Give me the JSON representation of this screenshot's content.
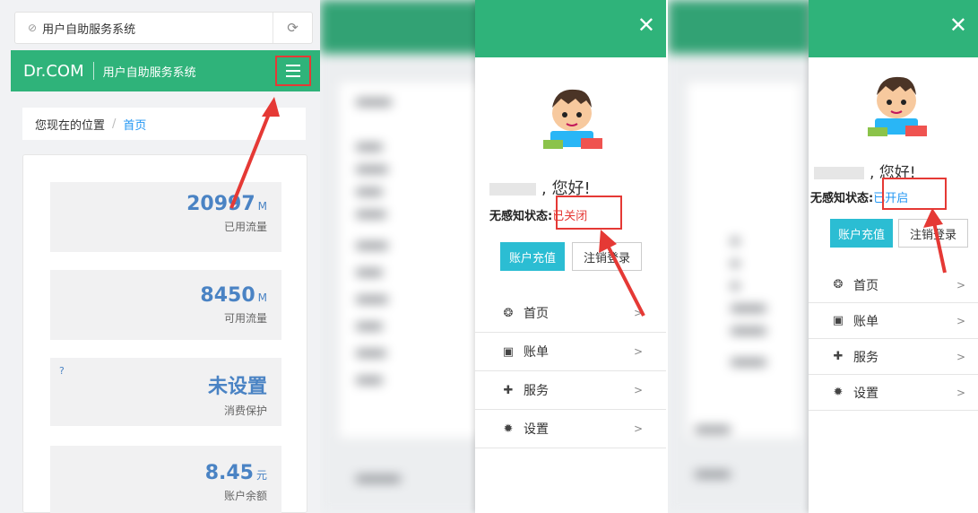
{
  "screen1": {
    "url_text": "用户自助服务系统",
    "lock_icon": "⊘",
    "reload_icon": "⟳",
    "brand": "Dr.COM",
    "system_name": "用户自助服务系统",
    "breadcrumb": {
      "prefix": "您现在的位置",
      "separator": "/",
      "current": "首页"
    },
    "stats": [
      {
        "value": "20997",
        "unit": "M",
        "label": "已用流量"
      },
      {
        "value": "8450",
        "unit": "M",
        "label": "可用流量"
      },
      {
        "value": "未设置",
        "unit": "",
        "label": "消费保护",
        "help": "?"
      },
      {
        "value": "8.45",
        "unit": "元",
        "label": "账户余额"
      }
    ]
  },
  "screen2": {
    "close_icon": "✕",
    "greeting": ", 您好!",
    "status_label": "无感知状态:",
    "status_value": "已关闭",
    "status_color": "#e53935",
    "btn_recharge": "账户充值",
    "btn_logout": "注销登录",
    "menu": [
      {
        "icon": "dashboard-icon",
        "glyph": "❂",
        "label": "首页",
        "chevron": ">"
      },
      {
        "icon": "bill-icon",
        "glyph": "▣",
        "label": "账单",
        "chevron": ">"
      },
      {
        "icon": "puzzle-icon",
        "glyph": "✚",
        "label": "服务",
        "chevron": ">"
      },
      {
        "icon": "gear-icon",
        "glyph": "✹",
        "label": "设置",
        "chevron": ">"
      }
    ]
  },
  "screen3": {
    "close_icon": "✕",
    "greeting": ", 您好!",
    "status_label": "无感知状态:",
    "status_value": "已开启",
    "status_color": "#2196f3",
    "btn_recharge": "账户充值",
    "btn_logout": "注销登录",
    "menu": [
      {
        "icon": "dashboard-icon",
        "glyph": "❂",
        "label": "首页",
        "chevron": ">"
      },
      {
        "icon": "bill-icon",
        "glyph": "▣",
        "label": "账单",
        "chevron": ">"
      },
      {
        "icon": "puzzle-icon",
        "glyph": "✚",
        "label": "服务",
        "chevron": ">"
      },
      {
        "icon": "gear-icon",
        "glyph": "✹",
        "label": "设置",
        "chevron": ">"
      }
    ]
  },
  "colors": {
    "brand_green": "#2fb37a",
    "accent_blue": "#4a83c4",
    "button_cyan": "#2bbdd3",
    "annotation_red": "#e53935"
  }
}
